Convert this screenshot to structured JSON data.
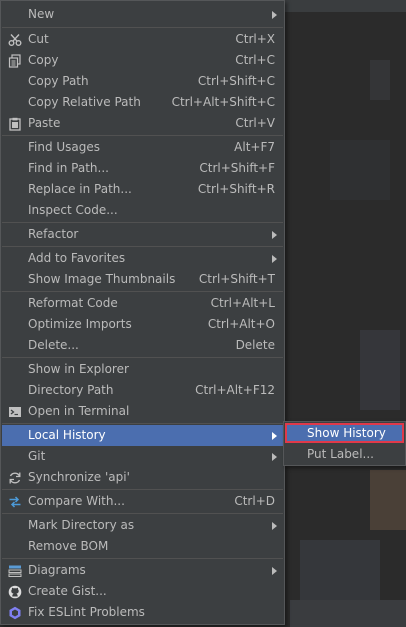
{
  "menu": {
    "items": [
      {
        "label": "New",
        "shortcut": "",
        "submenu": true,
        "icon": ""
      },
      {
        "label": "Cut",
        "shortcut": "Ctrl+X",
        "submenu": false,
        "icon": "scissors-icon"
      },
      {
        "label": "Copy",
        "shortcut": "Ctrl+C",
        "submenu": false,
        "icon": "copy-icon"
      },
      {
        "label": "Copy Path",
        "shortcut": "Ctrl+Shift+C",
        "submenu": false,
        "icon": ""
      },
      {
        "label": "Copy Relative Path",
        "shortcut": "Ctrl+Alt+Shift+C",
        "submenu": false,
        "icon": ""
      },
      {
        "label": "Paste",
        "shortcut": "Ctrl+V",
        "submenu": false,
        "icon": "paste-icon"
      },
      {
        "label": "Find Usages",
        "shortcut": "Alt+F7",
        "submenu": false,
        "icon": ""
      },
      {
        "label": "Find in Path...",
        "shortcut": "Ctrl+Shift+F",
        "submenu": false,
        "icon": ""
      },
      {
        "label": "Replace in Path...",
        "shortcut": "Ctrl+Shift+R",
        "submenu": false,
        "icon": ""
      },
      {
        "label": "Inspect Code...",
        "shortcut": "",
        "submenu": false,
        "icon": ""
      },
      {
        "label": "Refactor",
        "shortcut": "",
        "submenu": true,
        "icon": ""
      },
      {
        "label": "Add to Favorites",
        "shortcut": "",
        "submenu": true,
        "icon": ""
      },
      {
        "label": "Show Image Thumbnails",
        "shortcut": "Ctrl+Shift+T",
        "submenu": false,
        "icon": ""
      },
      {
        "label": "Reformat Code",
        "shortcut": "Ctrl+Alt+L",
        "submenu": false,
        "icon": ""
      },
      {
        "label": "Optimize Imports",
        "shortcut": "Ctrl+Alt+O",
        "submenu": false,
        "icon": ""
      },
      {
        "label": "Delete...",
        "shortcut": "Delete",
        "submenu": false,
        "icon": ""
      },
      {
        "label": "Show in Explorer",
        "shortcut": "",
        "submenu": false,
        "icon": ""
      },
      {
        "label": "Directory Path",
        "shortcut": "Ctrl+Alt+F12",
        "submenu": false,
        "icon": ""
      },
      {
        "label": "Open in Terminal",
        "shortcut": "",
        "submenu": false,
        "icon": "terminal-icon"
      },
      {
        "label": "Local History",
        "shortcut": "",
        "submenu": true,
        "icon": "",
        "active": true
      },
      {
        "label": "Git",
        "shortcut": "",
        "submenu": true,
        "icon": ""
      },
      {
        "label": "Synchronize 'api'",
        "shortcut": "",
        "submenu": false,
        "icon": "sync-icon"
      },
      {
        "label": "Compare With...",
        "shortcut": "Ctrl+D",
        "submenu": false,
        "icon": "compare-icon"
      },
      {
        "label": "Mark Directory as",
        "shortcut": "",
        "submenu": true,
        "icon": ""
      },
      {
        "label": "Remove BOM",
        "shortcut": "",
        "submenu": false,
        "icon": ""
      },
      {
        "label": "Diagrams",
        "shortcut": "",
        "submenu": true,
        "icon": "diagram-icon"
      },
      {
        "label": "Create Gist...",
        "shortcut": "",
        "submenu": false,
        "icon": "github-icon"
      },
      {
        "label": "Fix ESLint Problems",
        "shortcut": "",
        "submenu": false,
        "icon": "eslint-icon"
      }
    ]
  },
  "submenu": {
    "items": [
      {
        "label": "Show History",
        "active": true
      },
      {
        "label": "Put Label..."
      }
    ]
  },
  "colors": {
    "menu_bg": "#3c3f41",
    "highlight": "#4b6eaf",
    "focus_outline": "#e0394a",
    "text": "#bbbbbb"
  }
}
